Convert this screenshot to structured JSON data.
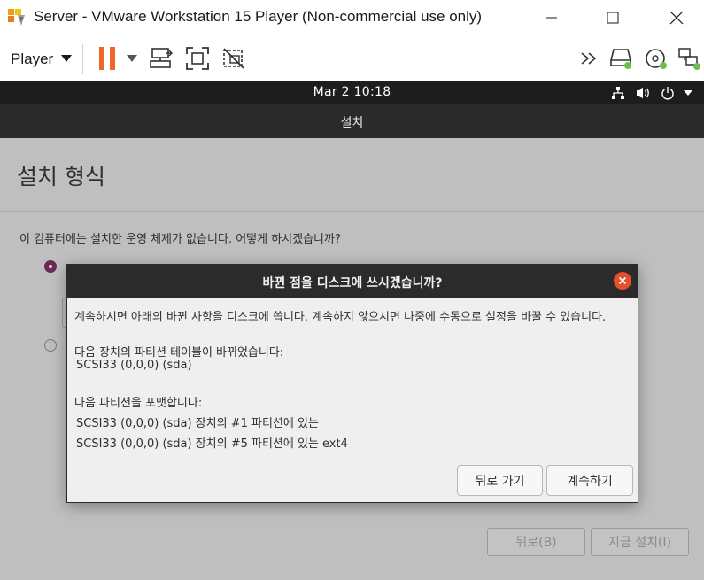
{
  "window": {
    "title": "Server - VMware Workstation 15 Player (Non-commercial use only)"
  },
  "toolbar": {
    "player_menu": "Player",
    "accent_pause": "#f0642a"
  },
  "ubuntu_bar": {
    "clock": "Mar 2  10:18"
  },
  "installer": {
    "header_title": "설치",
    "page_title": "설치 형식",
    "question": "이 컴퓨터에는 설치한 운영 체제가 없습니다. 어떻게 하시겠습니까?",
    "back_button": "뒤로(B)",
    "install_now_button": "지금 설치(I)",
    "accent_radio": "#6b2a53"
  },
  "dialog": {
    "title": "바뀐 점을 디스크에 쓰시겠습니까?",
    "intro": "계속하시면 아래의 바뀐 사항을 디스크에 씁니다. 계속하지 않으시면 나중에 수동으로 설정을 바꿀 수 있습니다.",
    "table_heading": "다음 장치의 파티션 테이블이 바뀌었습니다:",
    "table_device": "SCSI33 (0,0,0) (sda)",
    "format_heading": "다음 파티션을 포맷합니다:",
    "format_items": [
      "SCSI33 (0,0,0) (sda) 장치의 #1 파티션에 있는",
      "SCSI33 (0,0,0) (sda) 장치의 #5 파티션에 있는 ext4"
    ],
    "go_back_button": "뒤로 가기",
    "continue_button": "계속하기",
    "close_color": "#e2502c"
  }
}
